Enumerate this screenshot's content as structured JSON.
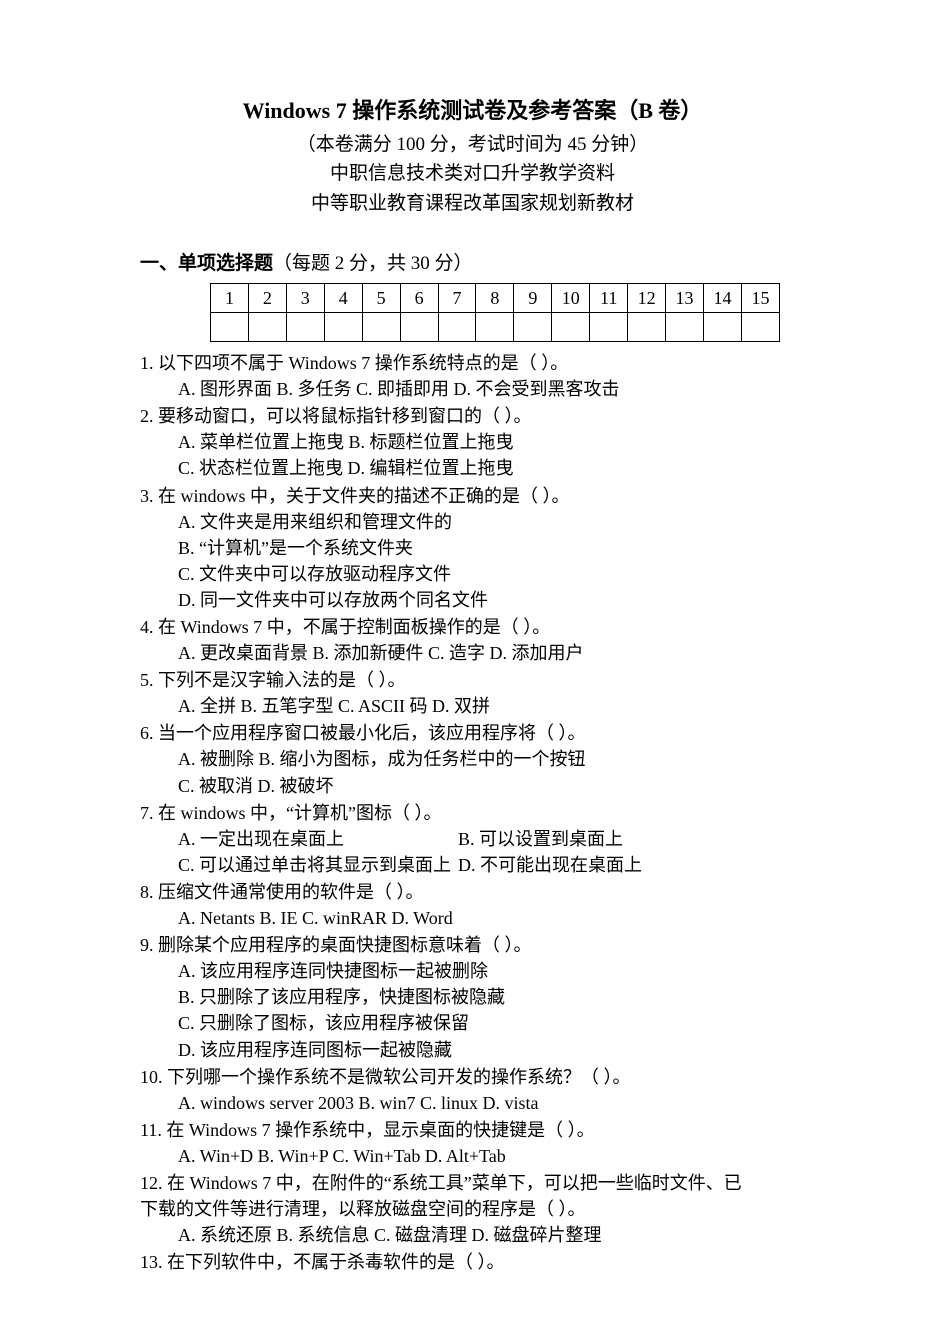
{
  "header": {
    "title": "Windows 7 操作系统测试卷及参考答案（B 卷）",
    "lines": [
      "（本卷满分 100 分，考试时间为 45 分钟）",
      "中职信息技术类对口升学教学资料",
      "中等职业教育课程改革国家规划新教材"
    ]
  },
  "section1": {
    "label": "一、单项选择题",
    "note": "（每题 2 分，共 30 分）",
    "table": {
      "cols": [
        "1",
        "2",
        "3",
        "4",
        "5",
        "6",
        "7",
        "8",
        "9",
        "10",
        "11",
        "12",
        "13",
        "14",
        "15"
      ],
      "answers": [
        "",
        "",
        "",
        "",
        "",
        "",
        "",
        "",
        "",
        "",
        "",
        "",
        "",
        "",
        ""
      ]
    }
  },
  "questions": [
    {
      "num": "1.",
      "text": "以下四项不属于 Windows 7 操作系统特点的是（  ）。",
      "layout": "inline",
      "opts": [
        "A. 图形界面",
        "B. 多任务",
        "C. 即插即用",
        "D. 不会受到黑客攻击"
      ]
    },
    {
      "num": "2.",
      "text": "要移动窗口，可以将鼠标指针移到窗口的（  ）。",
      "layout": "two-col",
      "opts": [
        "A. 菜单栏位置上拖曳",
        "B. 标题栏位置上拖曳",
        "C. 状态栏位置上拖曳",
        "D. 编辑栏位置上拖曳"
      ]
    },
    {
      "num": "3.",
      "text": "在 windows 中，关于文件夹的描述不正确的是（  ）。",
      "layout": "stack",
      "opts": [
        "A. 文件夹是用来组织和管理文件的",
        "B. “计算机”是一个系统文件夹",
        "C. 文件夹中可以存放驱动程序文件",
        "D. 同一文件夹中可以存放两个同名文件"
      ]
    },
    {
      "num": "4.",
      "text": "在 Windows 7 中，不属于控制面板操作的是（  ）。",
      "layout": "inline",
      "opts": [
        "A. 更改桌面背景",
        "B. 添加新硬件",
        "C. 造字",
        "D. 添加用户"
      ]
    },
    {
      "num": "5.",
      "text": "下列不是汉字输入法的是（  ）。",
      "layout": "inline",
      "opts": [
        "A. 全拼",
        "B. 五笔字型",
        "C. ASCII 码",
        "D. 双拼"
      ]
    },
    {
      "num": "6.",
      "text": "当一个应用程序窗口被最小化后，该应用程序将（  ）。",
      "layout": "two-col-wide",
      "opts": [
        "A. 被删除",
        "B. 缩小为图标，成为任务栏中的一个按钮",
        "C. 被取消",
        "D. 被破坏"
      ]
    },
    {
      "num": "7.",
      "text": "在 windows 中，“计算机”图标（  ）。",
      "layout": "two-col-right",
      "opts": [
        "A. 一定出现在桌面上",
        "B. 可以设置到桌面上",
        "C. 可以通过单击将其显示到桌面上",
        "D. 不可能出现在桌面上"
      ]
    },
    {
      "num": "8.",
      "text": "压缩文件通常使用的软件是（  ）。",
      "layout": "inline",
      "opts": [
        "A. Netants",
        "B. IE",
        "C. winRAR",
        "D. Word"
      ]
    },
    {
      "num": "9.",
      "text": "删除某个应用程序的桌面快捷图标意味着（  ）。",
      "layout": "stack",
      "opts": [
        "A. 该应用程序连同快捷图标一起被删除",
        "B. 只删除了该应用程序，快捷图标被隐藏",
        "C. 只删除了图标，该应用程序被保留",
        "D. 该应用程序连同图标一起被隐藏"
      ]
    },
    {
      "num": "10.",
      "text": "下列哪一个操作系统不是微软公司开发的操作系统？（  ）。",
      "layout": "inline",
      "opts": [
        "A. windows server 2003",
        "B. win7",
        "C. linux",
        "D. vista"
      ]
    },
    {
      "num": "11.",
      "text": "在 Windows 7 操作系统中，显示桌面的快捷键是（  ）。",
      "layout": "inline",
      "opts": [
        "A. Win+D",
        "B. Win+P",
        "C. Win+Tab",
        "D. Alt+Tab"
      ]
    },
    {
      "num": "12.",
      "text": "在 Windows 7 中，在附件的“系统工具”菜单下，可以把一些临时文件、已",
      "text2": "下载的文件等进行清理，以释放磁盘空间的程序是（  ）。",
      "layout": "inline",
      "opts": [
        "A. 系统还原",
        "B. 系统信息",
        "C. 磁盘清理",
        "D. 磁盘碎片整理"
      ]
    },
    {
      "num": "13.",
      "text": "在下列软件中，不属于杀毒软件的是（  ）。",
      "layout": "none",
      "opts": []
    }
  ]
}
